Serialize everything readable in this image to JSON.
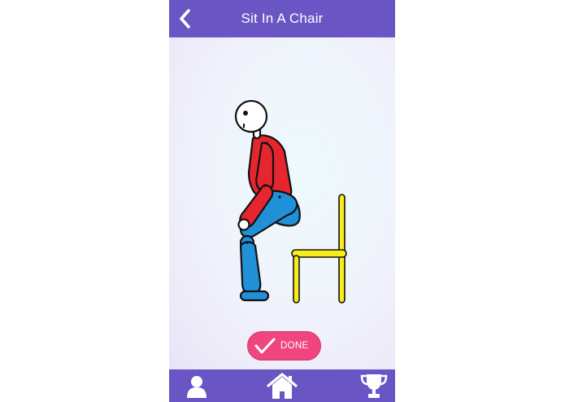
{
  "header": {
    "title": "Sit In A Chair",
    "back_icon": "chevron-left-icon"
  },
  "main": {
    "illustration": "person-sitting-into-chair",
    "done_label": "DONE",
    "done_icon": "checkmark-icon"
  },
  "bottom_nav": {
    "items": [
      {
        "icon": "person-icon"
      },
      {
        "icon": "home-icon"
      },
      {
        "icon": "trophy-icon"
      }
    ]
  },
  "colors": {
    "brand": "#6a55c4",
    "done_button": "#f0457d",
    "shirt": "#e5262f",
    "pants": "#2090d8",
    "chair": "#f7ec1c"
  }
}
